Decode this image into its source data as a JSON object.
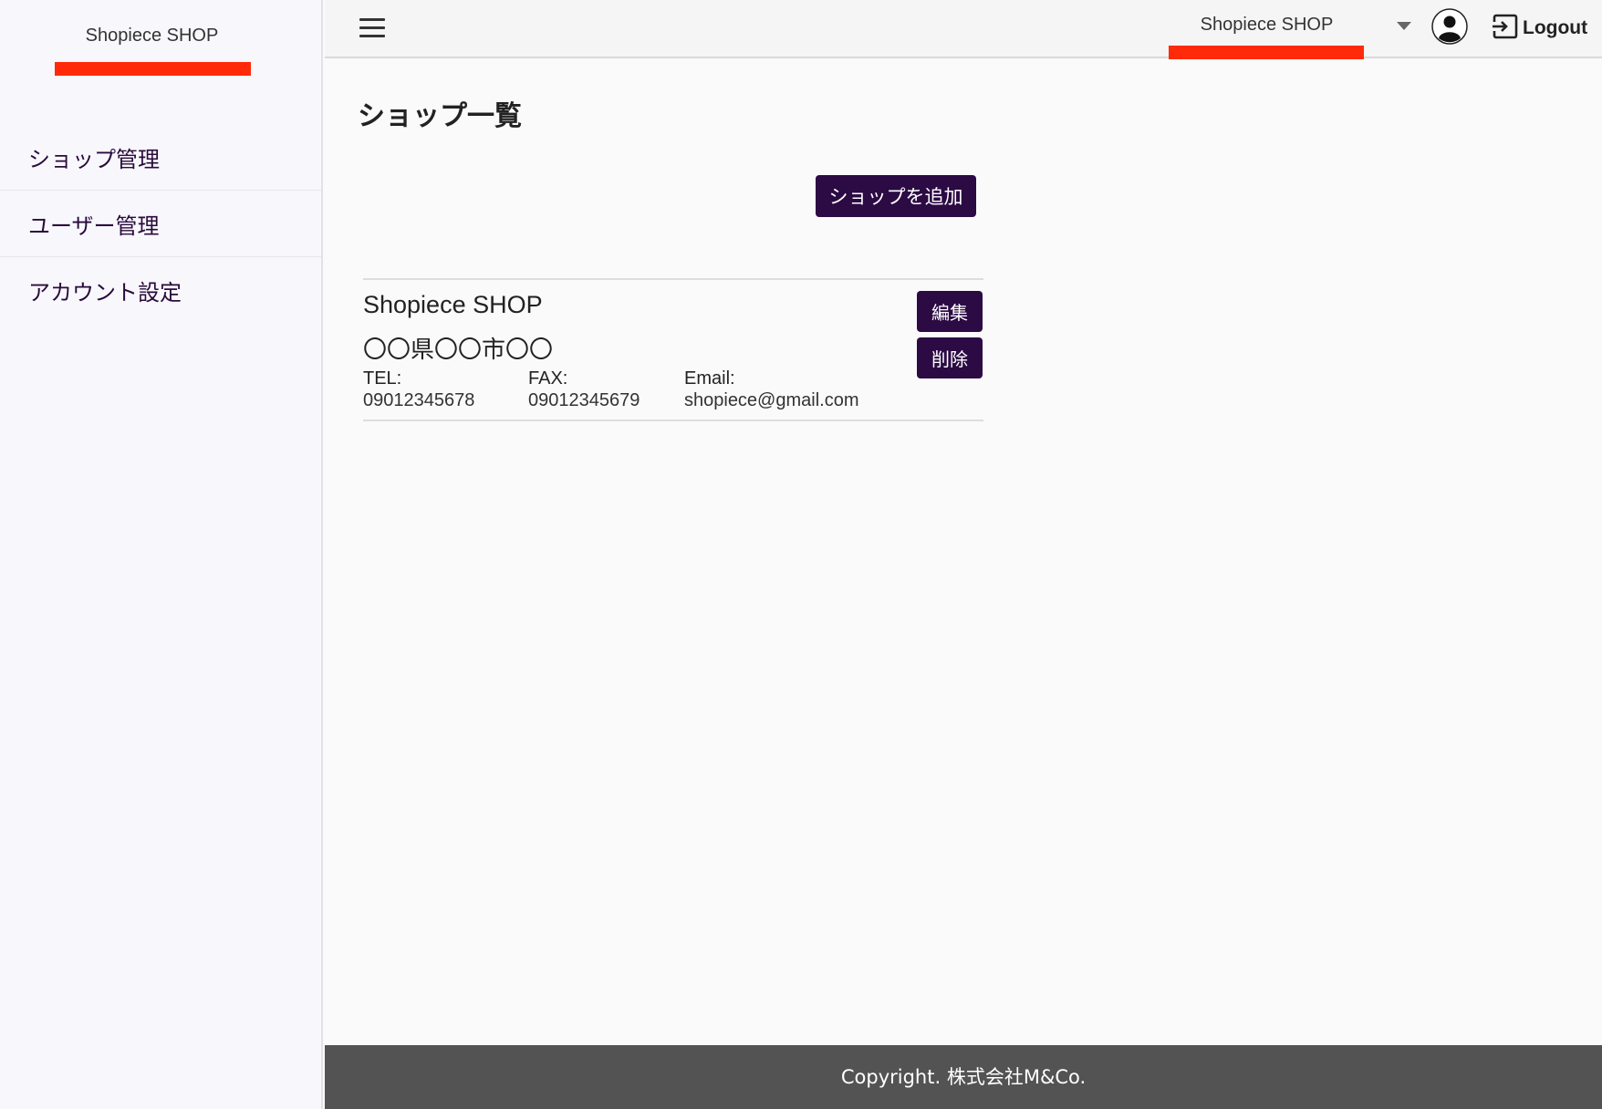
{
  "sidebar": {
    "brand": "Shopiece SHOP",
    "items": [
      {
        "label": "ショップ管理"
      },
      {
        "label": "ユーザー管理"
      },
      {
        "label": "アカウント設定"
      }
    ]
  },
  "header": {
    "selected_shop": "Shopiece SHOP",
    "logout_label": "Logout",
    "icons": {
      "menu": "hamburger-menu-icon",
      "dropdown": "chevron-down-icon",
      "avatar": "user-avatar-icon",
      "logout": "logout-icon"
    }
  },
  "main": {
    "title": "ショップ一覧",
    "add_button": "ショップを追加",
    "shops": [
      {
        "name": "Shopiece SHOP",
        "address": "〇〇県〇〇市〇〇",
        "tel_label": "TEL:",
        "tel": "09012345678",
        "fax_label": "FAX:",
        "fax": "09012345679",
        "email_label": "Email:",
        "email": "shopiece@gmail.com",
        "edit_label": "編集",
        "delete_label": "削除"
      }
    ]
  },
  "footer": {
    "copyright": "Copyright. 株式会社M&Co."
  },
  "colors": {
    "accent_purple": "#2c0a44",
    "highlight_red": "#ff2a0a",
    "footer_gray": "#535353"
  }
}
